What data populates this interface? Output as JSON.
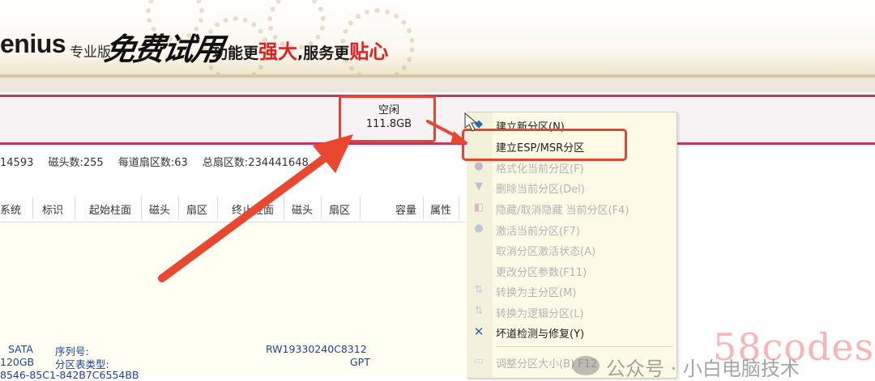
{
  "banner": {
    "brand": "enius",
    "edition": "专业版",
    "trial": "免费试用",
    "slogan_a": "功能更",
    "slogan_b": "强大",
    "slogan_c": ",服务更",
    "slogan_d": "贴心"
  },
  "partition": {
    "free_label": "空闲",
    "free_size": "111.8GB"
  },
  "disk_info": {
    "cylinders_tail": "14593",
    "heads": "磁头数:255",
    "sectors_per_track": "每道扇区数:63",
    "total_sectors": "总扇区数:234441648"
  },
  "table": {
    "headers": [
      "系统",
      "标识",
      "起始柱面",
      "磁头",
      "扇区",
      "终止柱面",
      "磁头",
      "扇区",
      "容量",
      "属性"
    ]
  },
  "disk_detail": {
    "iface_label": "SATA",
    "size": "120GB",
    "guid_partial": "8546-85C1-842B7C6554BB",
    "serial_label": "序列号:",
    "serial_value": "RW19330240C8312",
    "ptable_label": "分区表类型:",
    "ptable_value": "GPT"
  },
  "context_menu": {
    "items": [
      {
        "label": "建立新分区(N)",
        "enabled": true
      },
      {
        "label": "建立ESP/MSR分区",
        "enabled": true
      },
      {
        "label": "格式化当前分区(F)",
        "enabled": false
      },
      {
        "label": "删除当前分区(Del)",
        "enabled": false
      },
      {
        "label": "隐藏/取消隐藏 当前分区(F4)",
        "enabled": false
      },
      {
        "label": "激活当前分区(F7)",
        "enabled": false
      },
      {
        "label": "取消分区激活状态(A)",
        "enabled": false
      },
      {
        "label": "更改分区参数(F11)",
        "enabled": false
      },
      {
        "label": "转换为主分区(M)",
        "enabled": false
      },
      {
        "label": "转换为逻辑分区(L)",
        "enabled": false
      },
      {
        "label": "坏道检测与修复(Y)",
        "enabled": true
      },
      {
        "label": "调整分区大小(B) F12",
        "enabled": false
      }
    ]
  },
  "watermark": {
    "site": "58codes",
    "wechat": "公众号 · 小白电脑技术"
  },
  "colors": {
    "highlight_red": "#e44535",
    "disk_bar_border": "#c8355a",
    "menu_bg": "#fdfbe6",
    "detail_blue": "#1d3fa8"
  }
}
